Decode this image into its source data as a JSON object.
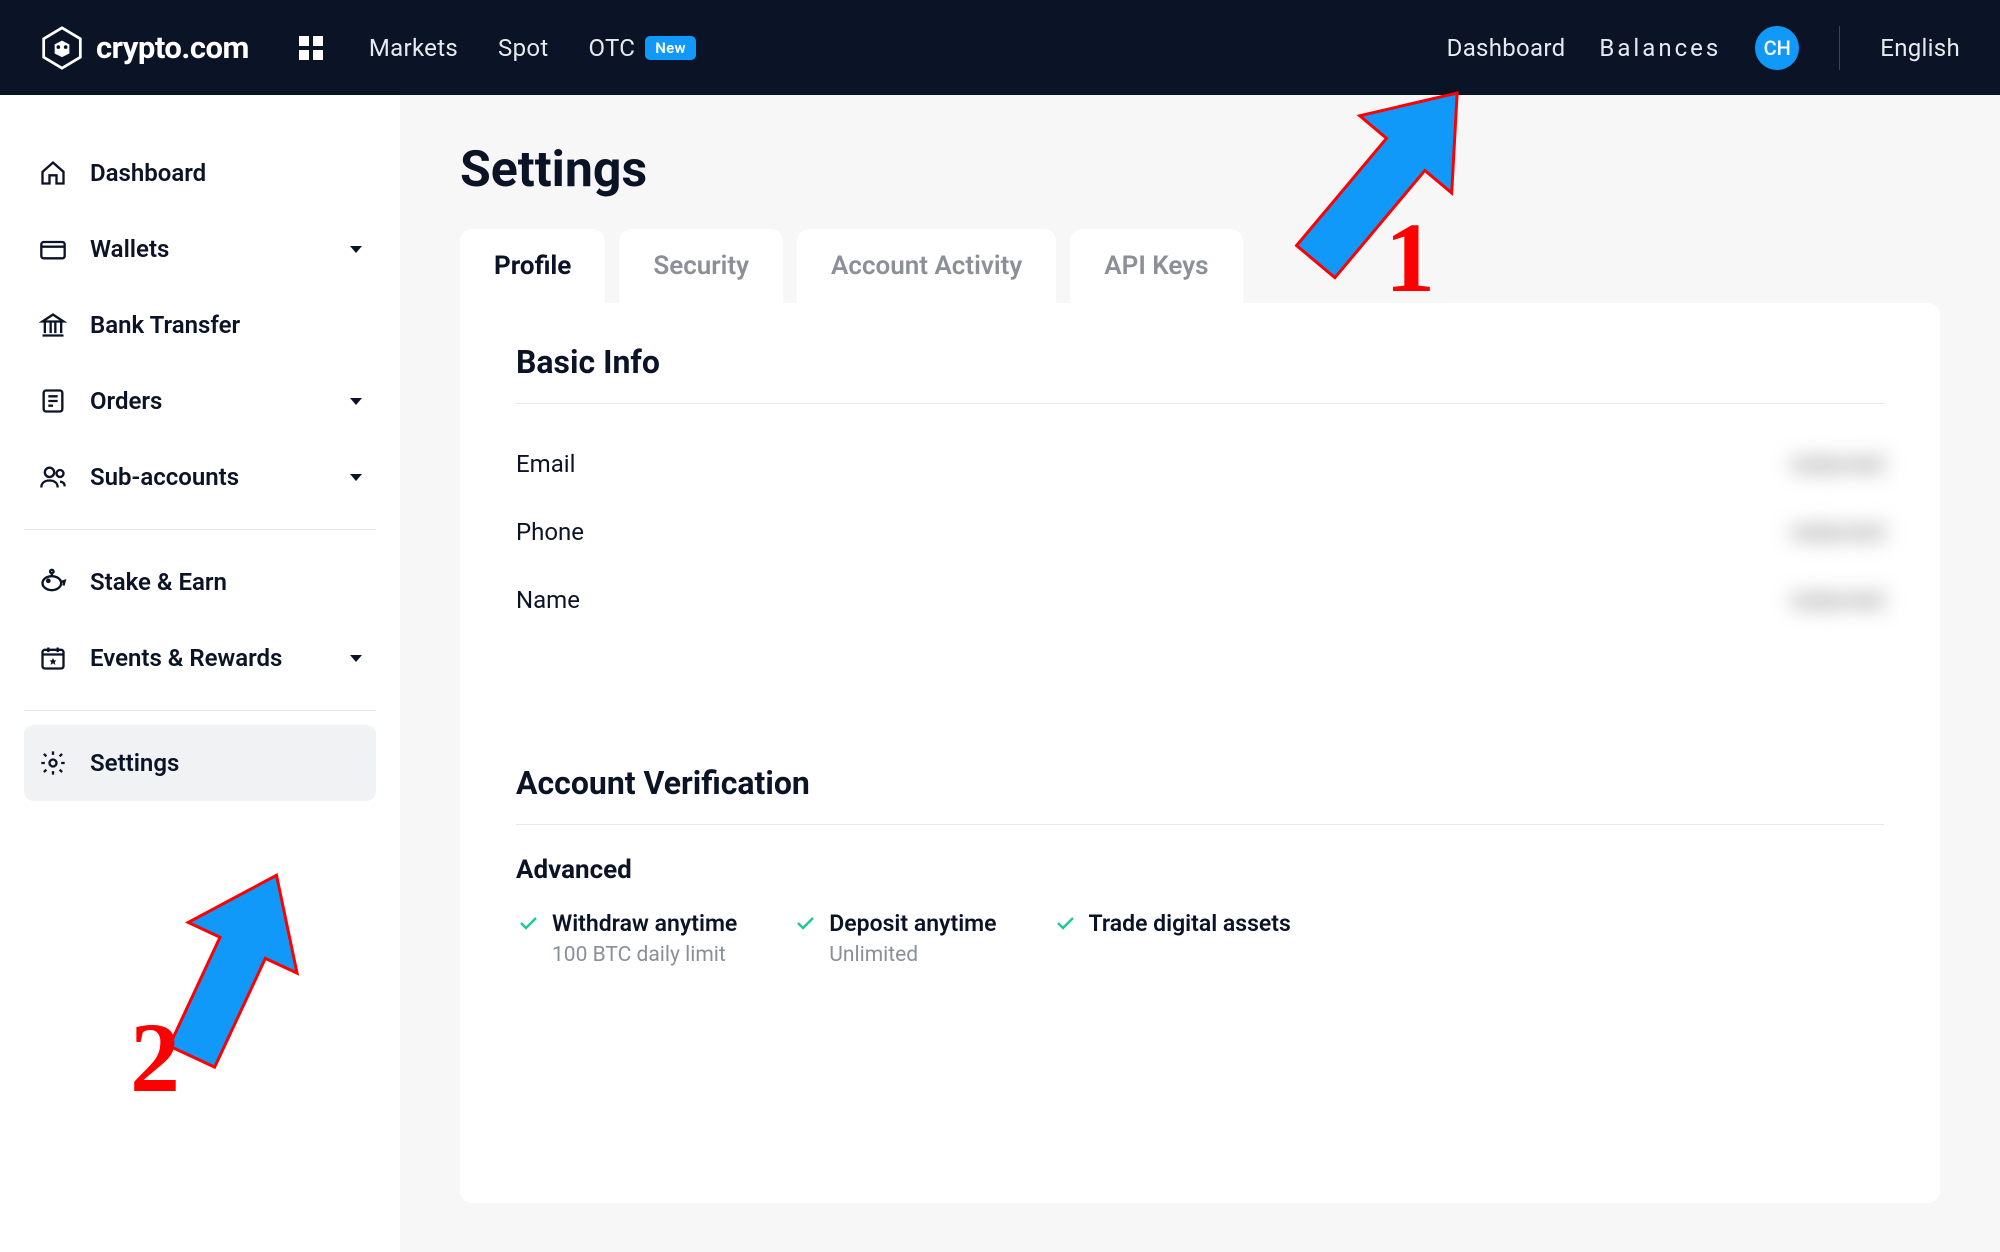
{
  "brand": {
    "name": "crypto.com"
  },
  "topnav": {
    "left": [
      {
        "label": "Markets"
      },
      {
        "label": "Spot"
      },
      {
        "label": "OTC",
        "badge": "New"
      }
    ],
    "right": {
      "dashboard": "Dashboard",
      "balances": "Balances",
      "avatar": "CH",
      "language": "English"
    }
  },
  "sidebar": {
    "items": [
      {
        "icon": "home",
        "label": "Dashboard"
      },
      {
        "icon": "wallet",
        "label": "Wallets",
        "expandable": true
      },
      {
        "icon": "bank",
        "label": "Bank Transfer"
      },
      {
        "icon": "orders",
        "label": "Orders",
        "expandable": true
      },
      {
        "icon": "users",
        "label": "Sub-accounts",
        "expandable": true
      },
      {
        "icon": "piggy",
        "label": "Stake & Earn",
        "sep_before": true
      },
      {
        "icon": "calendar",
        "label": "Events & Rewards",
        "expandable": true
      },
      {
        "icon": "gear",
        "label": "Settings",
        "active": true,
        "sep_before": true
      }
    ]
  },
  "page": {
    "title": "Settings",
    "tabs": [
      {
        "label": "Profile",
        "active": true
      },
      {
        "label": "Security"
      },
      {
        "label": "Account Activity"
      },
      {
        "label": "API Keys"
      }
    ],
    "basic_info": {
      "title": "Basic Info",
      "fields": {
        "email": {
          "label": "Email",
          "value": "redacted"
        },
        "phone": {
          "label": "Phone",
          "value": "redacted"
        },
        "name": {
          "label": "Name",
          "value": "redacted"
        }
      }
    },
    "verification": {
      "title": "Account Verification",
      "level": "Advanced",
      "features": [
        {
          "title": "Withdraw anytime",
          "sub": "100 BTC daily limit"
        },
        {
          "title": "Deposit anytime",
          "sub": "Unlimited"
        },
        {
          "title": "Trade digital assets"
        }
      ]
    }
  },
  "annotations": {
    "arrow1_num": "1",
    "arrow2_num": "2"
  }
}
